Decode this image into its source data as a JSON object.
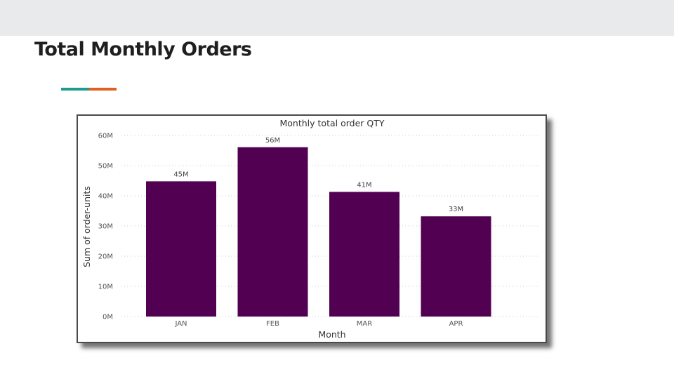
{
  "slide": {
    "title": "Total Monthly Orders",
    "accent_colors": [
      "#1f9a8f",
      "#e0611f"
    ]
  },
  "chart_data": {
    "type": "bar",
    "title": "Monthly total order QTY",
    "xlabel": "Month",
    "ylabel": "Sum of order-units",
    "categories": [
      "JAN",
      "FEB",
      "MAR",
      "APR"
    ],
    "values": [
      44.8,
      56.1,
      41.3,
      33.2
    ],
    "data_labels": [
      "45M",
      "56M",
      "41M",
      "33M"
    ],
    "y_ticks": [
      0,
      10,
      20,
      30,
      40,
      50,
      60
    ],
    "y_tick_labels": [
      "0M",
      "10M",
      "20M",
      "30M",
      "40M",
      "50M",
      "60M"
    ],
    "ylim": [
      0,
      60
    ],
    "unit": "M",
    "bar_color": "#510052",
    "grid": true
  }
}
